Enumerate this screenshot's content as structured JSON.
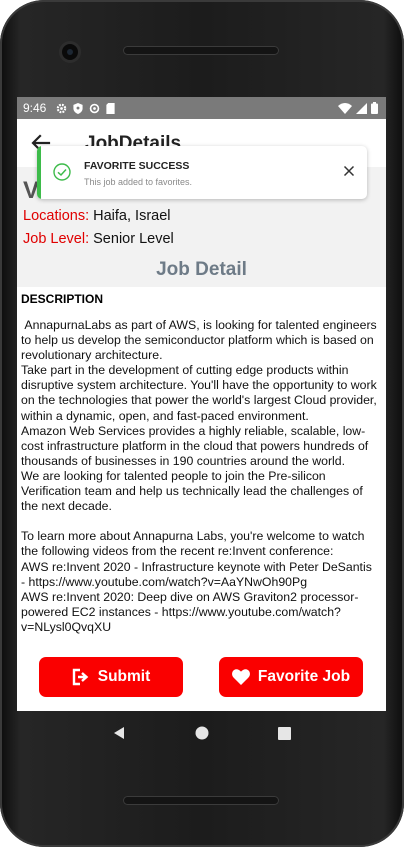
{
  "status_bar": {
    "time": "9:46"
  },
  "appbar": {
    "title": "JobDetails"
  },
  "job": {
    "title_initial": "V",
    "locations_label": "Locations:",
    "locations_value": " Haifa, Israel",
    "level_label": "Job Level:",
    "level_value": " Senior Level"
  },
  "section": {
    "heading": "Job Detail"
  },
  "description": {
    "title": "DESCRIPTION",
    "text": " AnnapurnaLabs as part of AWS, is looking for talented engineers to help us develop the semiconductor platform which is based on revolutionary architecture.\nTake part in the development of cutting edge products within disruptive system architecture. You'll have the opportunity to work on the technologies that power the world's largest Cloud provider, within a dynamic, open, and fast-paced environment.\nAmazon Web Services provides a highly reliable, scalable, low-cost infrastructure platform in the cloud that powers hundreds of thousands of businesses in 190 countries around the world.\nWe are looking for talented people to join the Pre-silicon Verification team and help us technically lead the challenges of the next decade.\n\nTo learn more about Annapurna Labs, you're welcome to watch the following videos from the recent re:Invent conference:\nAWS re:Invent 2020 - Infrastructure keynote with Peter DeSantis - https://www.youtube.com/watch?v=AaYNwOh90Pg\nAWS re:Invent 2020: Deep dive on AWS Graviton2 processor-powered EC2 instances - https://www.youtube.com/watch?v=NLysl0QvqXU"
  },
  "buttons": {
    "submit": "Submit",
    "favorite": "Favorite Job"
  },
  "toast": {
    "title": "FAVORITE SUCCESS",
    "message": "This job added to favorites."
  },
  "colors": {
    "accent_red": "#fa0000",
    "label_red": "#e00000",
    "success_green": "#3dbb4a",
    "heading_gray": "#6e7b87"
  },
  "icons": [
    "settings-icon",
    "shield-icon",
    "sync-icon",
    "sd-card-icon",
    "wifi-icon",
    "signal-icon",
    "battery-icon",
    "back-arrow-icon",
    "check-circle-icon",
    "close-icon",
    "exit-icon",
    "heart-icon",
    "nav-back-icon",
    "nav-home-icon",
    "nav-recents-icon"
  ]
}
